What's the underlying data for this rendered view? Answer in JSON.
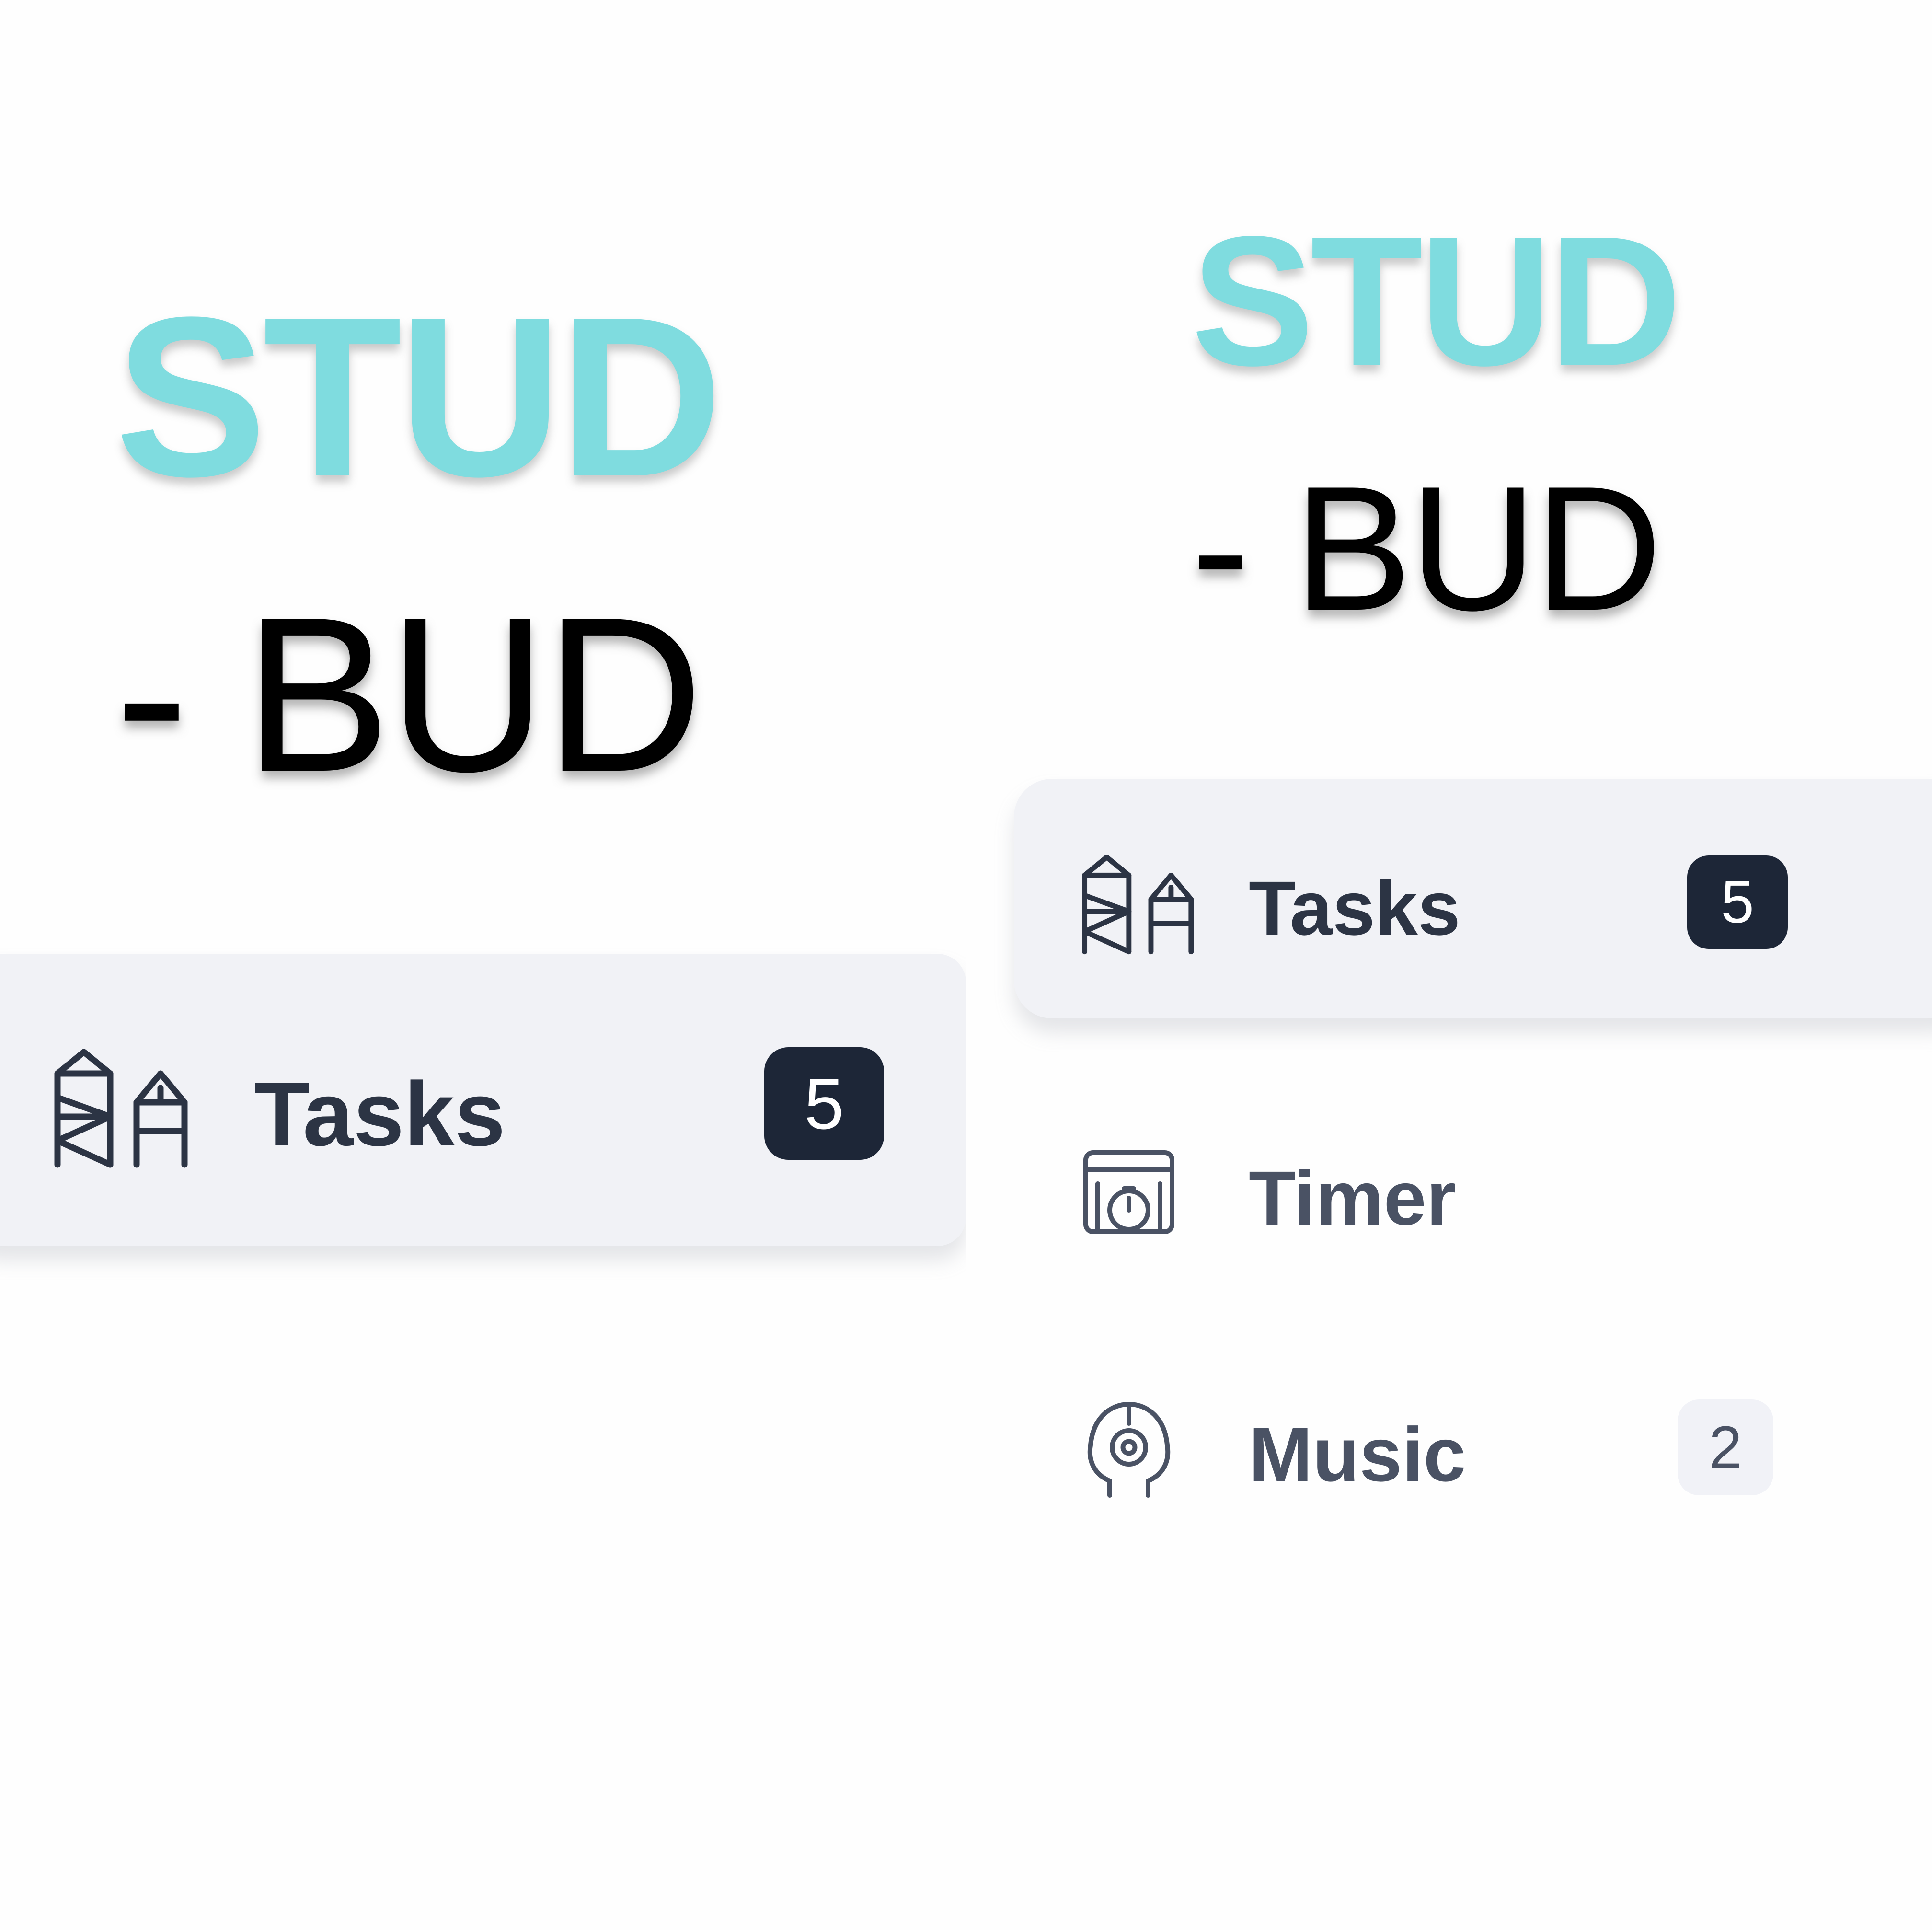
{
  "left_panel": {
    "logo": {
      "line1": "STUD",
      "line2": "- BUD"
    },
    "nav": {
      "tasks": {
        "label": "Tasks",
        "badge": "5",
        "icon": "tasks-buildings-icon"
      }
    }
  },
  "right_panel": {
    "logo": {
      "line1": "STUD",
      "line2": "- BUD"
    },
    "nav": {
      "tasks": {
        "label": "Tasks",
        "badge": "5",
        "icon": "tasks-buildings-icon"
      },
      "timer": {
        "label": "Timer",
        "icon": "timer-icon"
      },
      "music": {
        "label": "Music",
        "badge": "2",
        "icon": "music-icon"
      }
    }
  },
  "colors": {
    "logo_accent": "#7fdcdf",
    "logo_text": "#000000",
    "active_item_bg": "#f1f2f6",
    "badge_dark": "#1d2637",
    "badge_light": "#f1f2f7",
    "label_text": "#2c3444"
  }
}
